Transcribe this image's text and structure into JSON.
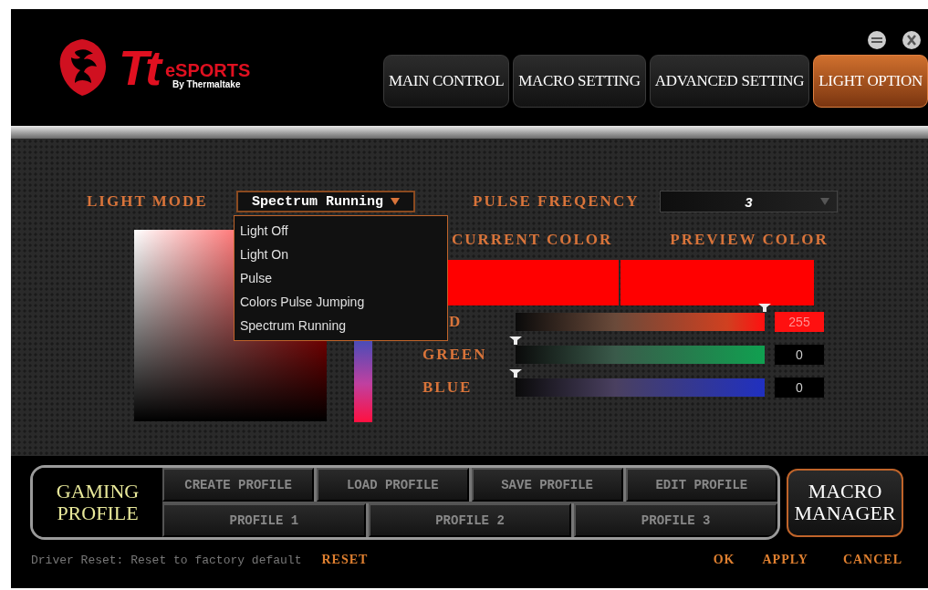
{
  "logo": {
    "mark": "Tt",
    "brand": "eSPORTS",
    "byline": "By Thermaltake"
  },
  "tabs": [
    {
      "label": "MAIN CONTROL",
      "selected": false
    },
    {
      "label": "MACRO SETTING",
      "selected": false
    },
    {
      "label": "ADVANCED SETTING",
      "selected": false
    },
    {
      "label": "LIGHT OPTION",
      "selected": true
    }
  ],
  "light_mode": {
    "label": "LIGHT MODE",
    "value": "Spectrum Running",
    "expanded": true,
    "options": [
      "Light Off",
      "Light On",
      "Pulse",
      "Colors Pulse Jumping",
      "Spectrum Running"
    ]
  },
  "pulse_frequency": {
    "label": "PULSE FREQENCY",
    "value": "3"
  },
  "current_color": {
    "label": "CURRENT COLOR",
    "color": "#ff0000"
  },
  "preview_color": {
    "label": "PREVIEW COLOR",
    "color": "#ff0000"
  },
  "channels": [
    {
      "kind": "red",
      "label": "D",
      "level": 1,
      "value": "255"
    },
    {
      "kind": "green",
      "label": "GREEN",
      "level": 0,
      "value": "0"
    },
    {
      "kind": "blue",
      "label": "BLUE",
      "level": 0,
      "value": "0"
    }
  ],
  "profile_group": {
    "label": "GAMING PROFILE",
    "actions": [
      "CREATE PROFILE",
      "LOAD PROFILE",
      "SAVE PROFILE",
      "EDIT PROFILE"
    ],
    "profiles": [
      "PROFILE 1",
      "PROFILE 2",
      "PROFILE 3"
    ]
  },
  "macro_manager": "MACRO MANAGER",
  "footer": {
    "driver_reset": "Driver Reset: Reset to factory default",
    "reset": "RESET",
    "buttons": [
      "OK",
      "APPLY",
      "CANCEL"
    ]
  }
}
